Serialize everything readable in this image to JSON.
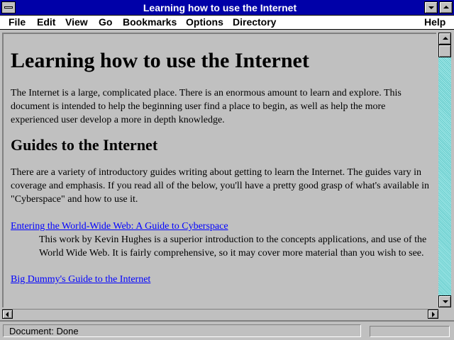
{
  "window": {
    "title": "Learning how to use the Internet"
  },
  "menubar": {
    "items": [
      {
        "label": "File"
      },
      {
        "label": "Edit"
      },
      {
        "label": "View"
      },
      {
        "label": "Go"
      },
      {
        "label": "Bookmarks"
      },
      {
        "label": "Options"
      },
      {
        "label": "Directory"
      },
      {
        "label": "Help"
      }
    ]
  },
  "document": {
    "heading": "Learning how to use the Internet",
    "intro": "The Internet is a large, complicated place. There is an enormous amount to learn and explore. This document is intended to help the beginning user find a place to begin, as well as help the more experienced user develop a more in depth knowledge.",
    "section_heading": "Guides to the Internet",
    "section_text": "There are a variety of introductory guides writing about getting to learn the Internet. The guides vary in coverage and emphasis. If you read all of the below, you'll have a pretty good grasp of what's available in \"Cyberspace\" and how to use it.",
    "guides": [
      {
        "link": "Entering the World-Wide Web: A Guide to Cyberspace",
        "description": "This work by Kevin Hughes is a superior introduction to the concepts applications, and use of the World Wide Web. It is fairly comprehensive, so it may cover more material than you wish to see."
      },
      {
        "link": "Big Dummy's Guide to the Internet",
        "description": ""
      }
    ]
  },
  "statusbar": {
    "text": "Document: Done",
    "progress": 0
  },
  "icons": {
    "system_menu": "system-menu-icon",
    "minimize": "minimize-icon",
    "maximize": "maximize-icon",
    "scroll_up": "arrow-up-icon",
    "scroll_down": "arrow-down-icon",
    "scroll_left": "arrow-left-icon",
    "scroll_right": "arrow-right-icon"
  },
  "colors": {
    "titlebar": "#0000a8",
    "link": "#0000ff",
    "background": "#c0c0c0",
    "scroll_track": "#7fdede"
  }
}
